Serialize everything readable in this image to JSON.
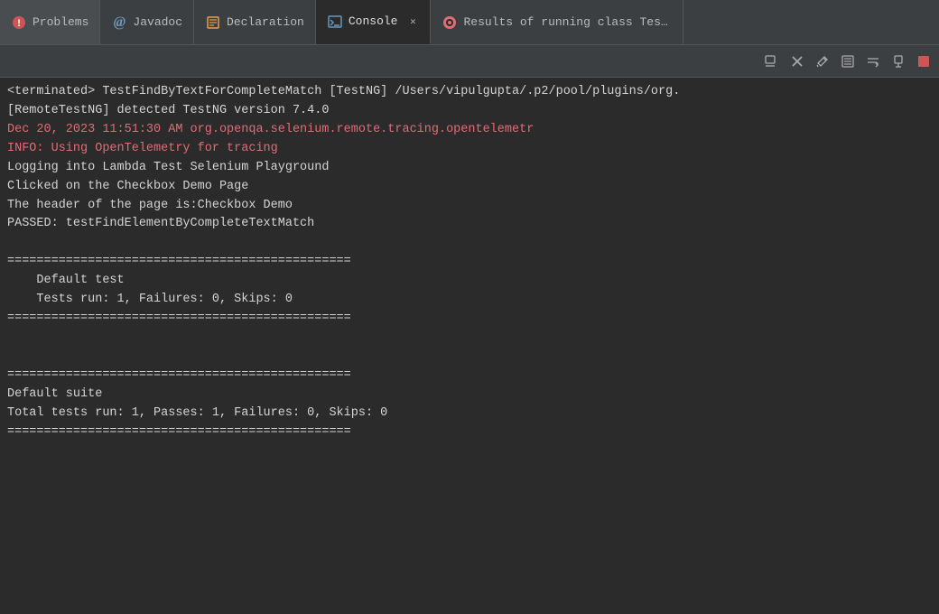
{
  "tabs": [
    {
      "id": "problems",
      "label": "Problems",
      "icon": "👤",
      "iconColor": "#e06c75",
      "active": false,
      "closeable": false
    },
    {
      "id": "javadoc",
      "label": "Javadoc",
      "icon": "@",
      "iconColor": "#6897bb",
      "active": false,
      "closeable": false
    },
    {
      "id": "declaration",
      "label": "Declaration",
      "icon": "📋",
      "iconColor": "#e5a04e",
      "active": false,
      "closeable": false
    },
    {
      "id": "console",
      "label": "Console",
      "icon": "🖥",
      "iconColor": "#6897bb",
      "active": true,
      "closeable": true
    },
    {
      "id": "results",
      "label": "Results of running class TestF",
      "icon": "🔧",
      "iconColor": "#e06c75",
      "active": false,
      "closeable": false
    }
  ],
  "toolbar": {
    "buttons": [
      {
        "name": "display-selected-console",
        "title": "Display Selected Console",
        "symbol": "▪",
        "disabled": false
      },
      {
        "name": "remove-console",
        "title": "Remove Console",
        "symbol": "✕",
        "disabled": false
      },
      {
        "name": "open-console",
        "title": "Open Console",
        "symbol": "⚙",
        "disabled": false
      },
      {
        "name": "scroll-lock",
        "title": "Scroll Lock",
        "symbol": "≡",
        "disabled": false
      },
      {
        "name": "word-wrap",
        "title": "Word Wrap",
        "symbol": "↵",
        "disabled": false
      },
      {
        "name": "pin-console",
        "title": "Pin Console",
        "symbol": "📌",
        "disabled": false
      },
      {
        "name": "terminate-launch",
        "title": "Terminate Launch",
        "symbol": "⏹",
        "disabled": false
      }
    ]
  },
  "console": {
    "lines": [
      {
        "text": "<terminated> TestFindByTextForCompleteMatch [TestNG] /Users/vipulgupta/.p2/pool/plugins/org.",
        "style": "normal"
      },
      {
        "text": "[RemoteTestNG] detected TestNG version 7.4.0",
        "style": "normal"
      },
      {
        "text": "Dec 20, 2023 11:51:30 AM org.openqa.selenium.remote.tracing.opentelemetr",
        "style": "red"
      },
      {
        "text": "INFO: Using OpenTelemetry for tracing",
        "style": "red"
      },
      {
        "text": "Logging into Lambda Test Selenium Playground",
        "style": "normal"
      },
      {
        "text": "Clicked on the Checkbox Demo Page",
        "style": "normal"
      },
      {
        "text": "The header of the page is:Checkbox Demo",
        "style": "normal"
      },
      {
        "text": "PASSED: testFindElementByCompleteTextMatch",
        "style": "normal"
      },
      {
        "text": "",
        "style": "empty"
      },
      {
        "text": "===============================================",
        "style": "normal"
      },
      {
        "text": "    Default test",
        "style": "normal"
      },
      {
        "text": "    Tests run: 1, Failures: 0, Skips: 0",
        "style": "normal"
      },
      {
        "text": "===============================================",
        "style": "normal"
      },
      {
        "text": "",
        "style": "empty"
      },
      {
        "text": "",
        "style": "empty"
      },
      {
        "text": "===============================================",
        "style": "normal"
      },
      {
        "text": "Default suite",
        "style": "normal"
      },
      {
        "text": "Total tests run: 1, Passes: 1, Failures: 0, Skips: 0",
        "style": "normal"
      },
      {
        "text": "===============================================",
        "style": "normal"
      }
    ]
  }
}
